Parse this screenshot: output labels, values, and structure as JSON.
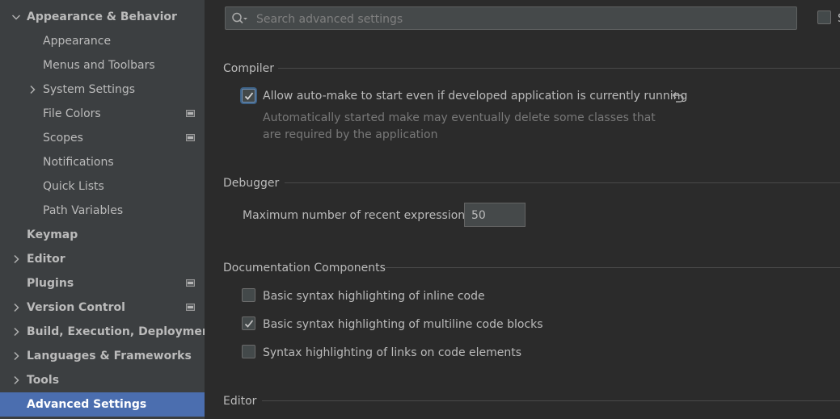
{
  "sidebar": {
    "items": [
      {
        "label": "Appearance & Behavior",
        "bold": true,
        "expand": "open"
      },
      {
        "label": "Appearance"
      },
      {
        "label": "Menus and Toolbars"
      },
      {
        "label": "System Settings",
        "expand": "closed"
      },
      {
        "label": "File Colors",
        "badge": true
      },
      {
        "label": "Scopes",
        "badge": true
      },
      {
        "label": "Notifications"
      },
      {
        "label": "Quick Lists"
      },
      {
        "label": "Path Variables"
      },
      {
        "label": "Keymap",
        "bold": true
      },
      {
        "label": "Editor",
        "bold": true,
        "expand": "closed"
      },
      {
        "label": "Plugins",
        "bold": true,
        "badge": true
      },
      {
        "label": "Version Control",
        "bold": true,
        "expand": "closed",
        "badge": true
      },
      {
        "label": "Build, Execution, Deployment",
        "bold": true,
        "expand": "closed"
      },
      {
        "label": "Languages & Frameworks",
        "bold": true,
        "expand": "closed"
      },
      {
        "label": "Tools",
        "bold": true,
        "expand": "closed"
      },
      {
        "label": "Advanced Settings",
        "bold": true,
        "selected": true
      }
    ]
  },
  "search": {
    "placeholder": "Search advanced settings",
    "icon": "search-icon"
  },
  "top_right": {
    "checked": false,
    "label_fragment": "S"
  },
  "compiler": {
    "title": "Compiler",
    "option": {
      "label": "Allow auto-make to start even if developed application is currently running",
      "checked": true,
      "hint_line1": "Automatically started make may eventually delete some classes that",
      "hint_line2": "are required by the application"
    }
  },
  "debugger": {
    "title": "Debugger",
    "max_expressions_label": "Maximum number of recent expressions:",
    "max_expressions_value": "50"
  },
  "documentation": {
    "title": "Documentation Components",
    "options": [
      {
        "label": "Basic syntax highlighting of inline code",
        "checked": false
      },
      {
        "label": "Basic syntax highlighting of multiline code blocks",
        "checked": true
      },
      {
        "label": "Syntax highlighting of links on code elements",
        "checked": false
      }
    ]
  },
  "editor": {
    "title": "Editor"
  },
  "colors": {
    "sidebar_bg": "#3c3f41",
    "main_bg": "#2b2b2b",
    "selection": "#4b6eaf"
  }
}
